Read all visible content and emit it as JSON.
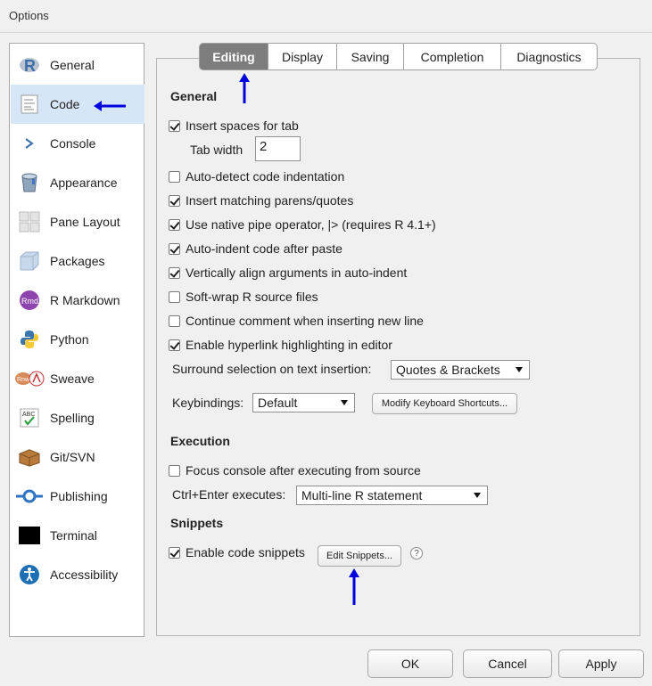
{
  "window": {
    "title": "Options"
  },
  "sidebar": {
    "items": [
      {
        "label": "General",
        "icon": "r-logo-icon"
      },
      {
        "label": "Code",
        "icon": "code-file-icon",
        "selected": true
      },
      {
        "label": "Console",
        "icon": "console-prompt-icon"
      },
      {
        "label": "Appearance",
        "icon": "paint-bucket-icon"
      },
      {
        "label": "Pane Layout",
        "icon": "pane-layout-icon"
      },
      {
        "label": "Packages",
        "icon": "package-box-icon"
      },
      {
        "label": "R Markdown",
        "icon": "rmd-icon"
      },
      {
        "label": "Python",
        "icon": "python-icon"
      },
      {
        "label": "Sweave",
        "icon": "sweave-icon"
      },
      {
        "label": "Spelling",
        "icon": "spelling-icon"
      },
      {
        "label": "Git/SVN",
        "icon": "git-box-icon"
      },
      {
        "label": "Publishing",
        "icon": "publishing-icon"
      },
      {
        "label": "Terminal",
        "icon": "terminal-icon"
      },
      {
        "label": "Accessibility",
        "icon": "accessibility-icon"
      }
    ]
  },
  "tabs": [
    {
      "label": "Editing",
      "active": true
    },
    {
      "label": "Display"
    },
    {
      "label": "Saving"
    },
    {
      "label": "Completion"
    },
    {
      "label": "Diagnostics"
    }
  ],
  "general": {
    "heading": "General",
    "insert_spaces": {
      "label": "Insert spaces for tab",
      "checked": true
    },
    "tab_width": {
      "label": "Tab width",
      "value": "2"
    },
    "auto_detect": {
      "label": "Auto-detect code indentation",
      "checked": false
    },
    "matching_parens": {
      "label": "Insert matching parens/quotes",
      "checked": true
    },
    "native_pipe": {
      "label": "Use native pipe operator, |> (requires R 4.1+)",
      "checked": true
    },
    "auto_indent": {
      "label": "Auto-indent code after paste",
      "checked": true
    },
    "vertical_align": {
      "label": "Vertically align arguments in auto-indent",
      "checked": true
    },
    "soft_wrap": {
      "label": "Soft-wrap R source files",
      "checked": false
    },
    "continue_comment": {
      "label": "Continue comment when inserting new line",
      "checked": false
    },
    "hyperlink": {
      "label": "Enable hyperlink highlighting in editor",
      "checked": true
    },
    "surround": {
      "label": "Surround selection on text insertion:",
      "value": "Quotes & Brackets"
    },
    "keybindings": {
      "label": "Keybindings:",
      "value": "Default"
    },
    "modify_shortcuts_label": "Modify Keyboard Shortcuts..."
  },
  "execution": {
    "heading": "Execution",
    "focus_console": {
      "label": "Focus console after executing from source",
      "checked": false
    },
    "ctrl_enter": {
      "label": "Ctrl+Enter executes:",
      "value": "Multi-line R statement"
    }
  },
  "snippets": {
    "heading": "Snippets",
    "enable": {
      "label": "Enable code snippets",
      "checked": true
    },
    "edit_label": "Edit Snippets...",
    "help_label": "?"
  },
  "footer": {
    "ok": "OK",
    "cancel": "Cancel",
    "apply": "Apply"
  },
  "annotation_color": "#0000dd"
}
